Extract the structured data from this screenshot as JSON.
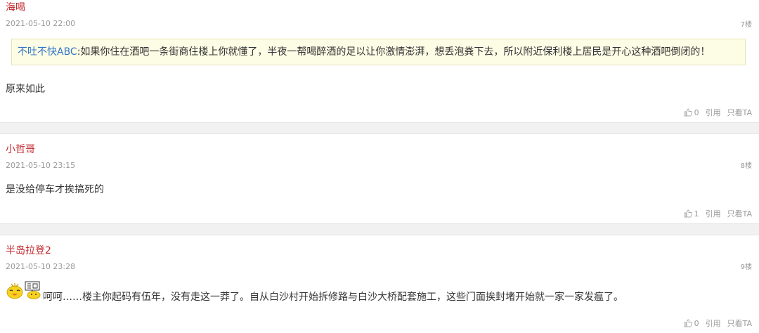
{
  "posts": [
    {
      "author": "海喝",
      "time": "2021-05-10 22:00",
      "floor": "7楼",
      "quote_name": "不吐不快ABC",
      "quote_text": ":如果你住在酒吧一条街商住楼上你就懂了，半夜一帮喝醉酒的足以让你激情澎湃，想丢泡粪下去，所以附近保利楼上居民是开心这种酒吧倒闭的！",
      "content": "原来如此",
      "likes": "0",
      "cite_label": "引用",
      "only_label": "只看TA"
    },
    {
      "author": "小哲哥",
      "time": "2021-05-10 23:15",
      "floor": "8楼",
      "content": "是没给停车才挨搞死的",
      "likes": "1",
      "cite_label": "引用",
      "only_label": "只看TA"
    },
    {
      "author": "半岛拉登2",
      "time": "2021-05-10 23:28",
      "floor": "9楼",
      "content": "呵呵……楼主你起码有伍年，没有走这一莽了。自从白沙村开始拆修路与白沙大桥配套施工，这些门面挨封堵开始就一家一家发瘟了。",
      "likes": "0",
      "cite_label": "引用",
      "only_label": "只看TA"
    }
  ],
  "icons": {
    "thumb": "thumbs-up-icon",
    "emoji_1": "laughing-chick-emoji-icon",
    "emoji_2": "sign-holding-emoji-icon"
  },
  "colors": {
    "author": "#c0282d",
    "quote_name": "#3275c6",
    "quote_bg": "#fdfde6"
  }
}
